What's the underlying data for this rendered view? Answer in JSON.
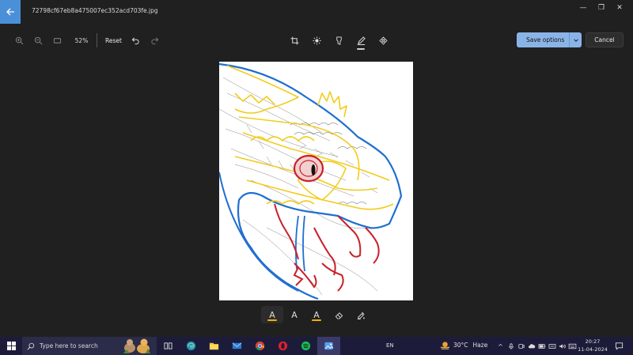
{
  "titlebar": {
    "filename": "72798cf67eb8a475007ec352acd703fe.jpg",
    "minimize_glyph": "—",
    "maximize_glyph": "❐",
    "close_glyph": "✕"
  },
  "toolbar": {
    "zoom_percent": "52%",
    "reset_label": "Reset",
    "save_label": "Save options",
    "cancel_label": "Cancel",
    "active_tool": "markup"
  },
  "markup_tools": [
    {
      "name": "ballpoint-pen",
      "letter": "A",
      "color": "#f5b000",
      "selected": true
    },
    {
      "name": "pencil",
      "letter": "A",
      "color": "#cccccc",
      "selected": false
    },
    {
      "name": "highlighter",
      "letter": "A",
      "color": "#f5b000",
      "selected": false
    },
    {
      "name": "eraser",
      "letter": "",
      "color": "#cccccc",
      "selected": false
    },
    {
      "name": "touch-writing",
      "letter": "",
      "color": "#cccccc",
      "selected": false
    }
  ],
  "taskbar": {
    "search_placeholder": "Type here to search",
    "language": "EN",
    "temperature": "30°C",
    "weather_condition": "Haze",
    "time": "20:27",
    "date": "11-04-2024"
  },
  "colors": {
    "accent": "#8ab4e8",
    "back_button": "#4a90d9",
    "background": "#202020",
    "taskbar": "#1c1c3a"
  }
}
